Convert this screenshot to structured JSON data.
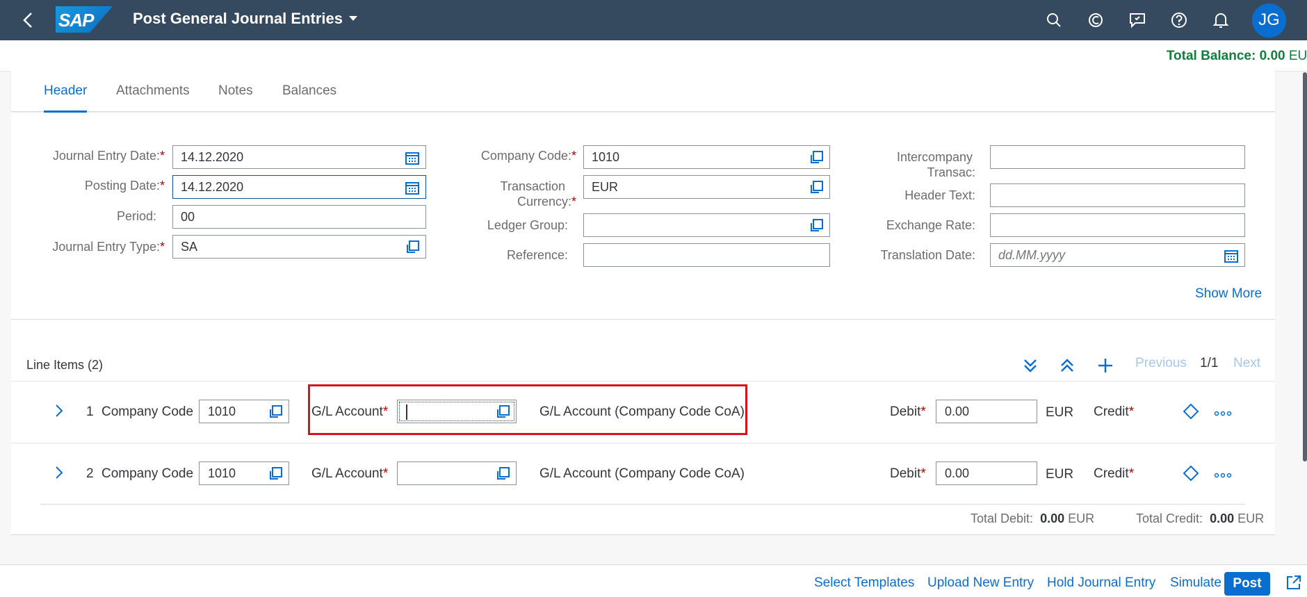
{
  "shell": {
    "title": "Post General Journal Entries",
    "logo_text": "SAP",
    "avatar_initials": "JG",
    "icons": [
      "back-icon",
      "search-icon",
      "copilot-icon",
      "feedback-icon",
      "help-icon",
      "notifications-icon"
    ]
  },
  "balance": {
    "label": "Total Balance:",
    "value": "0.00",
    "currency": "EUR"
  },
  "tabs": [
    "Header",
    "Attachments",
    "Notes",
    "Balances"
  ],
  "form": {
    "journal_entry_date": {
      "label": "Journal Entry Date:",
      "value": "14.12.2020"
    },
    "posting_date": {
      "label": "Posting Date:",
      "value": "14.12.2020"
    },
    "period": {
      "label": "Period:",
      "value": "00"
    },
    "journal_entry_type": {
      "label": "Journal Entry Type:",
      "value": "SA"
    },
    "company_code": {
      "label": "Company Code:",
      "value": "1010"
    },
    "transaction_currency": {
      "label_line1": "Transaction",
      "label_line2": "Currency:",
      "value": "EUR"
    },
    "ledger_group": {
      "label": "Ledger Group:",
      "value": ""
    },
    "reference": {
      "label": "Reference:",
      "value": ""
    },
    "intercompany": {
      "label_line1": "Intercompany",
      "label_line2": "Transac:",
      "value": ""
    },
    "header_text": {
      "label": "Header Text:",
      "value": ""
    },
    "exchange_rate": {
      "label": "Exchange Rate:",
      "value": ""
    },
    "translation_date": {
      "label": "Translation Date:",
      "placeholder": "dd.MM.yyyy"
    },
    "required_mark": "*",
    "show_more": "Show More"
  },
  "line_items": {
    "title": "Line Items (2)",
    "previous": "Previous",
    "page": "1/1",
    "next": "Next",
    "rows": [
      {
        "num": "1",
        "cc_label": "Company Code",
        "cc_value": "1010",
        "gl_label": "G/L Account",
        "gl_value": "",
        "gl_desc": "G/L Account (Company Code CoA)",
        "debit_label": "Debit",
        "debit_value": "0.00",
        "currency": "EUR",
        "credit_label": "Credit"
      },
      {
        "num": "2",
        "cc_label": "Company Code",
        "cc_value": "1010",
        "gl_label": "G/L Account",
        "gl_value": "",
        "gl_desc": "G/L Account (Company Code CoA)",
        "debit_label": "Debit",
        "debit_value": "0.00",
        "currency": "EUR",
        "credit_label": "Credit"
      }
    ],
    "total_debit_label": "Total Debit:",
    "total_debit_value": "0.00",
    "total_credit_label": "Total Credit:",
    "total_credit_value": "0.00",
    "total_currency": "EUR"
  },
  "footer": {
    "select_templates": "Select Templates",
    "upload_new_entry": "Upload New Entry",
    "hold_journal_entry": "Hold Journal Entry",
    "simulate": "Simulate",
    "post": "Post"
  },
  "colors": {
    "shell": "#354a5f",
    "accent": "#0a6ed1",
    "balance": "#107e3e",
    "required": "#bb0000",
    "highlight": "#d3141c"
  }
}
